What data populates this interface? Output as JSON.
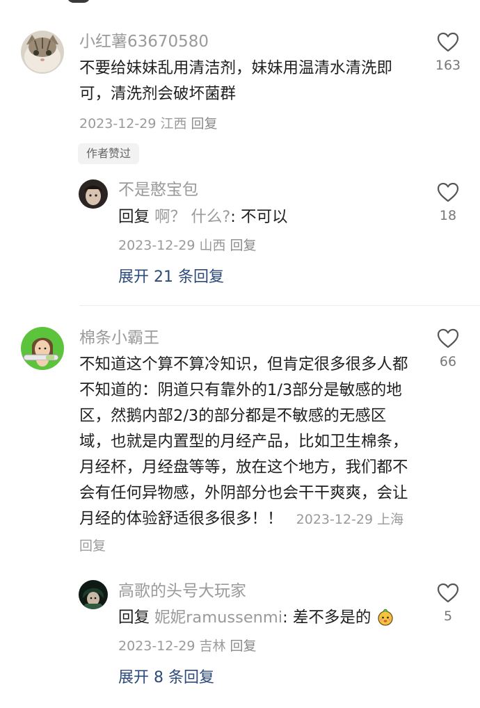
{
  "comments": [
    {
      "name": "小红薯63670580",
      "text": "不要给妹妹乱用清洁剂，妹妹用温清水清洗即可，清洗剂会破坏菌群",
      "date": "2023-12-29",
      "location": "江西",
      "reply_label": "回复",
      "likes": "163",
      "badge": "作者赞过",
      "replies": [
        {
          "name": "不是憨宝包",
          "prefix": "回复",
          "quoted": "啊？ 什么?",
          "text": ": 不可以",
          "date": "2023-12-29",
          "location": "山西",
          "reply_label": "回复",
          "likes": "18"
        }
      ],
      "expand_label": "展开 21 条回复"
    },
    {
      "name": "棉条小霸王",
      "text": "不知道这个算不算冷知识，但肯定很多很多人都不知道的：阴道只有靠外的1/3部分是敏感的地区，然鹅内部2/3的部分都是不敏感的无感区域，也就是内置型的月经产品，比如卫生棉条，月经杯，月经盘等等，放在这个地方，我们都不会有任何异物感，外阴部分也会干干爽爽，会让月经的体验舒适很多很多！！",
      "date": "2023-12-29",
      "location": "上海",
      "reply_label": "回复",
      "likes": "66",
      "replies": [
        {
          "name": "高歌的头号大玩家",
          "prefix": "回复",
          "quoted": "妮妮ramussenmi",
          "text": ": 差不多是的",
          "date": "2023-12-29",
          "location": "吉林",
          "reply_label": "回复",
          "likes": "5"
        }
      ],
      "expand_label": "展开 8 条回复"
    }
  ]
}
